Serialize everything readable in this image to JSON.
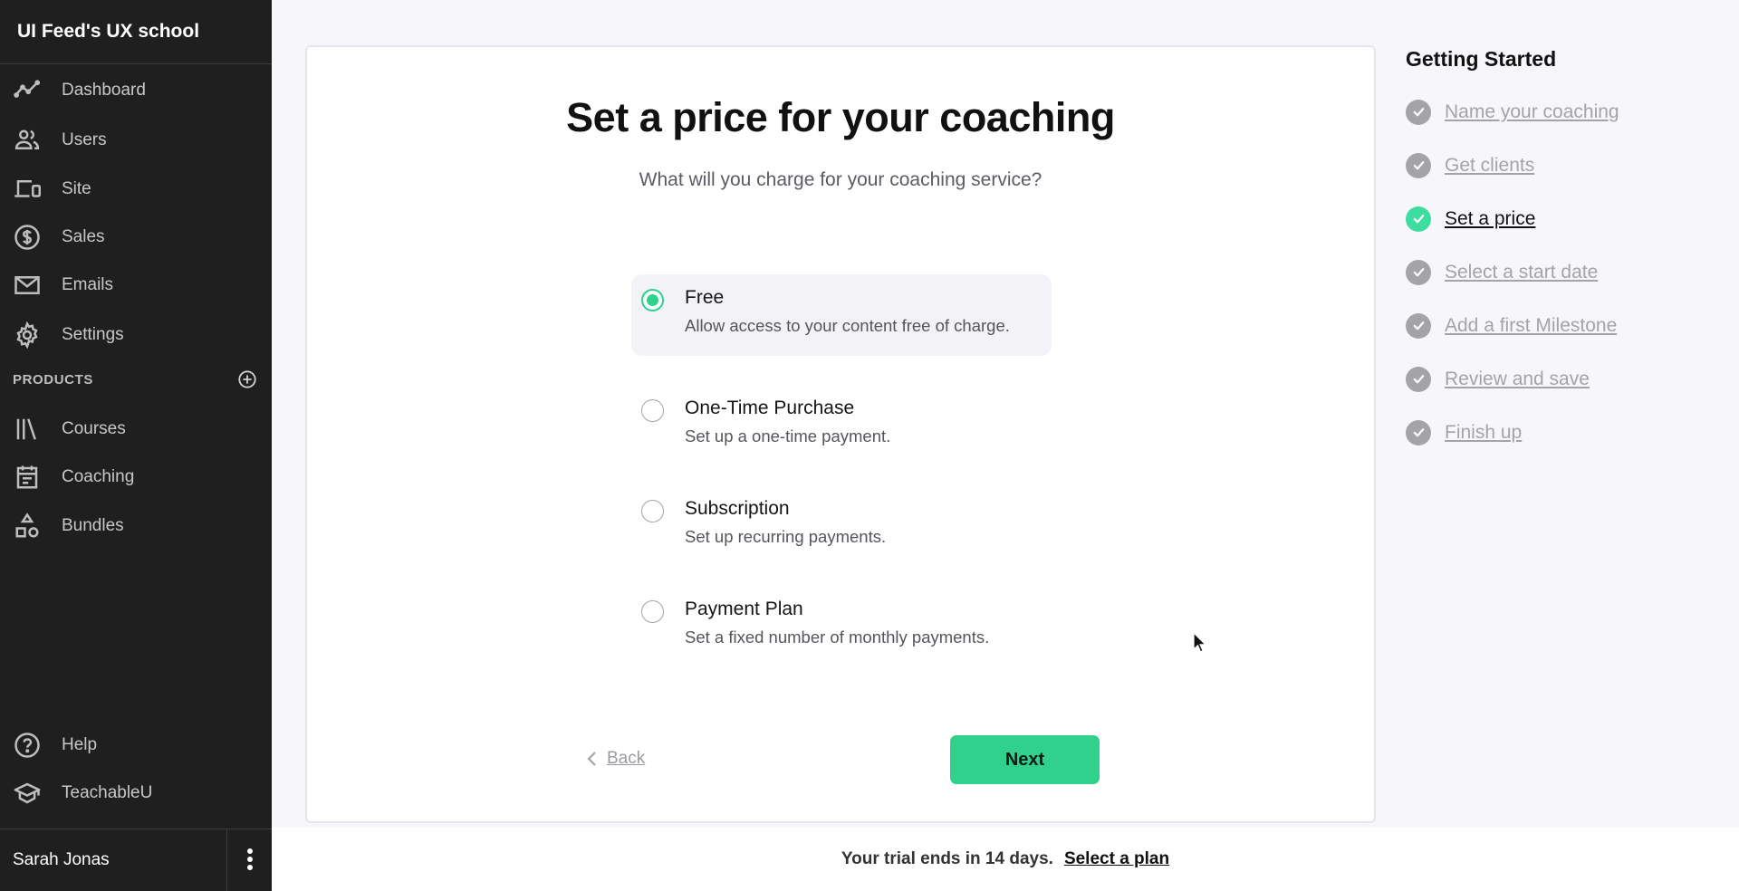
{
  "sidebar": {
    "brand": "UI Feed's UX school",
    "nav": [
      {
        "label": "Dashboard",
        "icon": "chart-line-icon"
      },
      {
        "label": "Users",
        "icon": "users-icon"
      },
      {
        "label": "Site",
        "icon": "devices-icon"
      },
      {
        "label": "Sales",
        "icon": "dollar-icon"
      },
      {
        "label": "Emails",
        "icon": "mail-icon"
      },
      {
        "label": "Settings",
        "icon": "gear-icon"
      }
    ],
    "products_header": "PRODUCTS",
    "products": [
      {
        "label": "Courses",
        "icon": "library-icon"
      },
      {
        "label": "Coaching",
        "icon": "calendar-icon"
      },
      {
        "label": "Bundles",
        "icon": "shapes-icon"
      }
    ],
    "bottom": [
      {
        "label": "Help",
        "icon": "help-icon"
      },
      {
        "label": "TeachableU",
        "icon": "graduation-cap-icon"
      }
    ],
    "user_name": "Sarah Jonas"
  },
  "main": {
    "title": "Set a price for your coaching",
    "subtitle": "What will you charge for your coaching service?",
    "options": [
      {
        "title": "Free",
        "description": "Allow access to your content free of charge.",
        "selected": true
      },
      {
        "title": "One-Time Purchase",
        "description": "Set up a one-time payment.",
        "selected": false
      },
      {
        "title": "Subscription",
        "description": "Set up recurring payments.",
        "selected": false
      },
      {
        "title": "Payment Plan",
        "description": "Set a fixed number of monthly payments.",
        "selected": false
      }
    ],
    "back_label": "Back",
    "next_label": "Next"
  },
  "getting_started": {
    "title": "Getting Started",
    "steps": [
      {
        "label": "Name your coaching",
        "state": "done"
      },
      {
        "label": "Get clients",
        "state": "done"
      },
      {
        "label": "Set a price",
        "state": "active"
      },
      {
        "label": "Select a start date",
        "state": "done"
      },
      {
        "label": "Add a first Milestone",
        "state": "done"
      },
      {
        "label": "Review and save",
        "state": "done"
      },
      {
        "label": "Finish up",
        "state": "done"
      }
    ]
  },
  "trial": {
    "message": "Your trial ends in 14 days.",
    "link": "Select a plan"
  },
  "colors": {
    "accent": "#2fd18c",
    "sidebar_bg": "#1f1f1f",
    "step_done": "#a3a3a8",
    "step_active": "#3ddca0"
  }
}
